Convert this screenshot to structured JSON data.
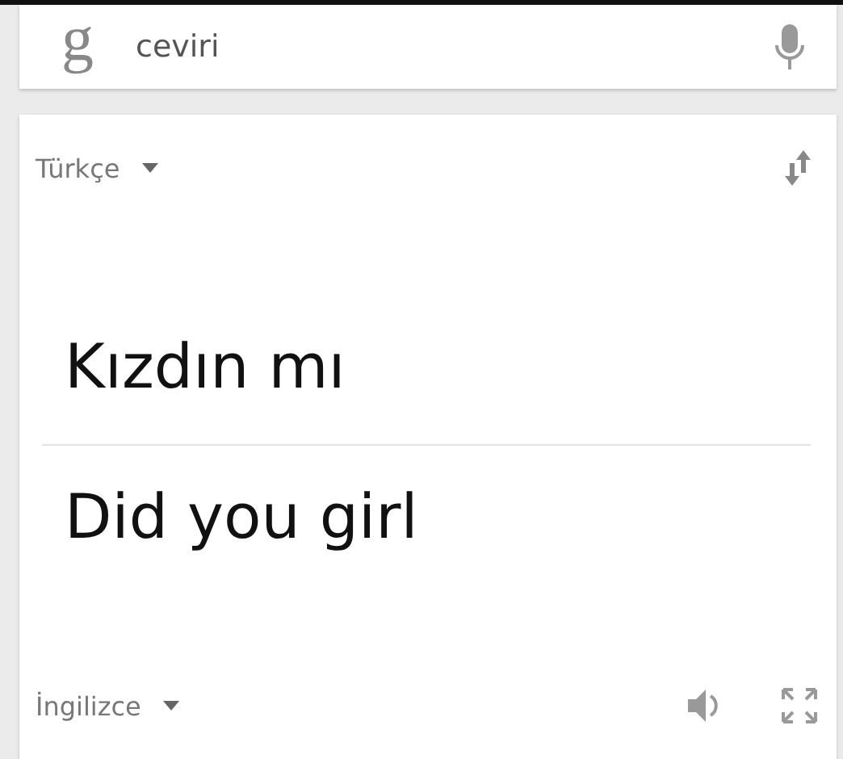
{
  "search": {
    "logo": "g",
    "query": "ceviri"
  },
  "translation": {
    "source_language": "Türkçe",
    "source_text": "Kızdın mı",
    "target_text": "Did you girl",
    "target_language": "İngilizce"
  }
}
